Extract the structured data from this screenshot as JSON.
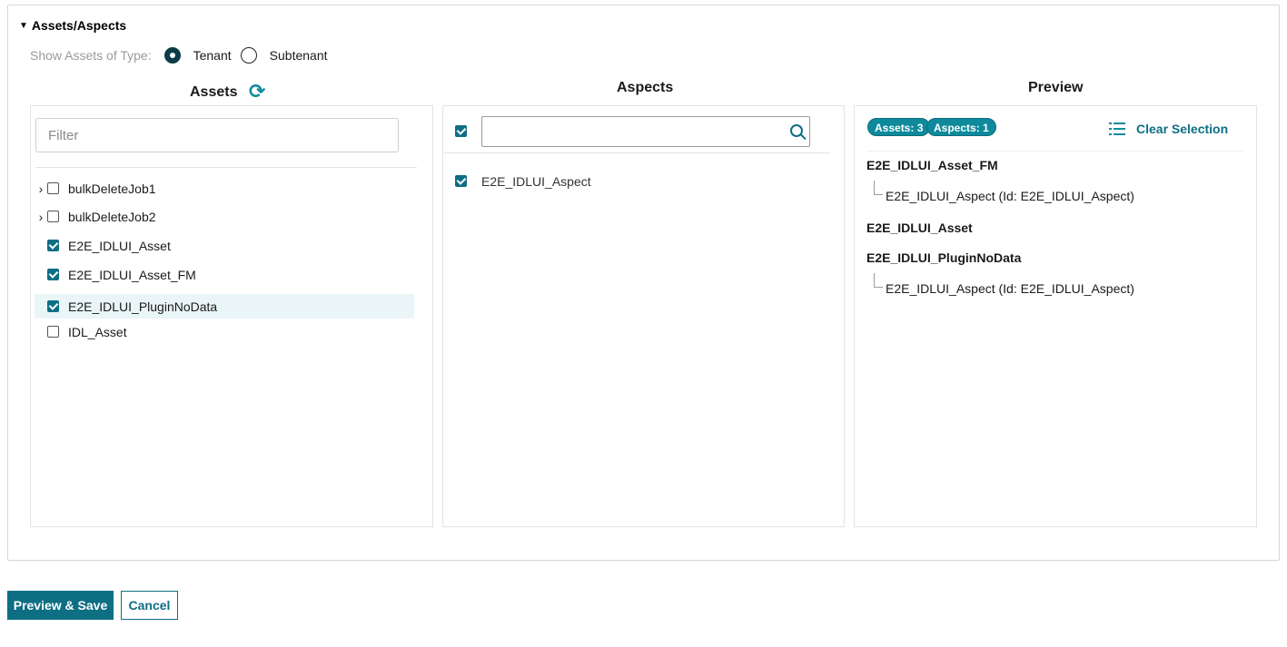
{
  "section": {
    "title": "Assets/Aspects"
  },
  "asset_type": {
    "label": "Show Assets of Type:",
    "options": [
      {
        "label": "Tenant",
        "selected": true
      },
      {
        "label": "Subtenant",
        "selected": false
      }
    ]
  },
  "assets_panel": {
    "title": "Assets",
    "filter_placeholder": "Filter",
    "items": [
      {
        "label": "bulkDeleteJob1",
        "checked": false,
        "expandable": true
      },
      {
        "label": "bulkDeleteJob2",
        "checked": false,
        "expandable": true
      },
      {
        "label": "E2E_IDLUI_Asset",
        "checked": true,
        "expandable": false
      },
      {
        "label": "E2E_IDLUI_Asset_FM",
        "checked": true,
        "expandable": false
      },
      {
        "label": "E2E_IDLUI_PluginNoData",
        "checked": true,
        "expandable": false,
        "selected": true
      },
      {
        "label": "IDL_Asset",
        "checked": false,
        "expandable": false
      }
    ]
  },
  "aspects_panel": {
    "title": "Aspects",
    "search_value": "",
    "select_all_checked": true,
    "items": [
      {
        "label": "E2E_IDLUI_Aspect",
        "checked": true
      }
    ]
  },
  "preview_panel": {
    "title": "Preview",
    "badge_assets": "Assets: 3",
    "badge_aspects": "Aspects: 1",
    "clear_label": "Clear Selection",
    "entries": [
      {
        "asset": "E2E_IDLUI_Asset_FM",
        "aspect": "E2E_IDLUI_Aspect (Id: E2E_IDLUI_Aspect)"
      },
      {
        "asset": "E2E_IDLUI_Asset",
        "aspect": ""
      },
      {
        "asset": "E2E_IDLUI_PluginNoData",
        "aspect": "E2E_IDLUI_Aspect (Id: E2E_IDLUI_Aspect)"
      }
    ]
  },
  "actions": {
    "preview_save": "Preview & Save",
    "cancel": "Cancel"
  },
  "colors": {
    "accent": "#0e6e84",
    "accent_light": "#0e8a9c",
    "selected_row": "#e9f5f7"
  }
}
